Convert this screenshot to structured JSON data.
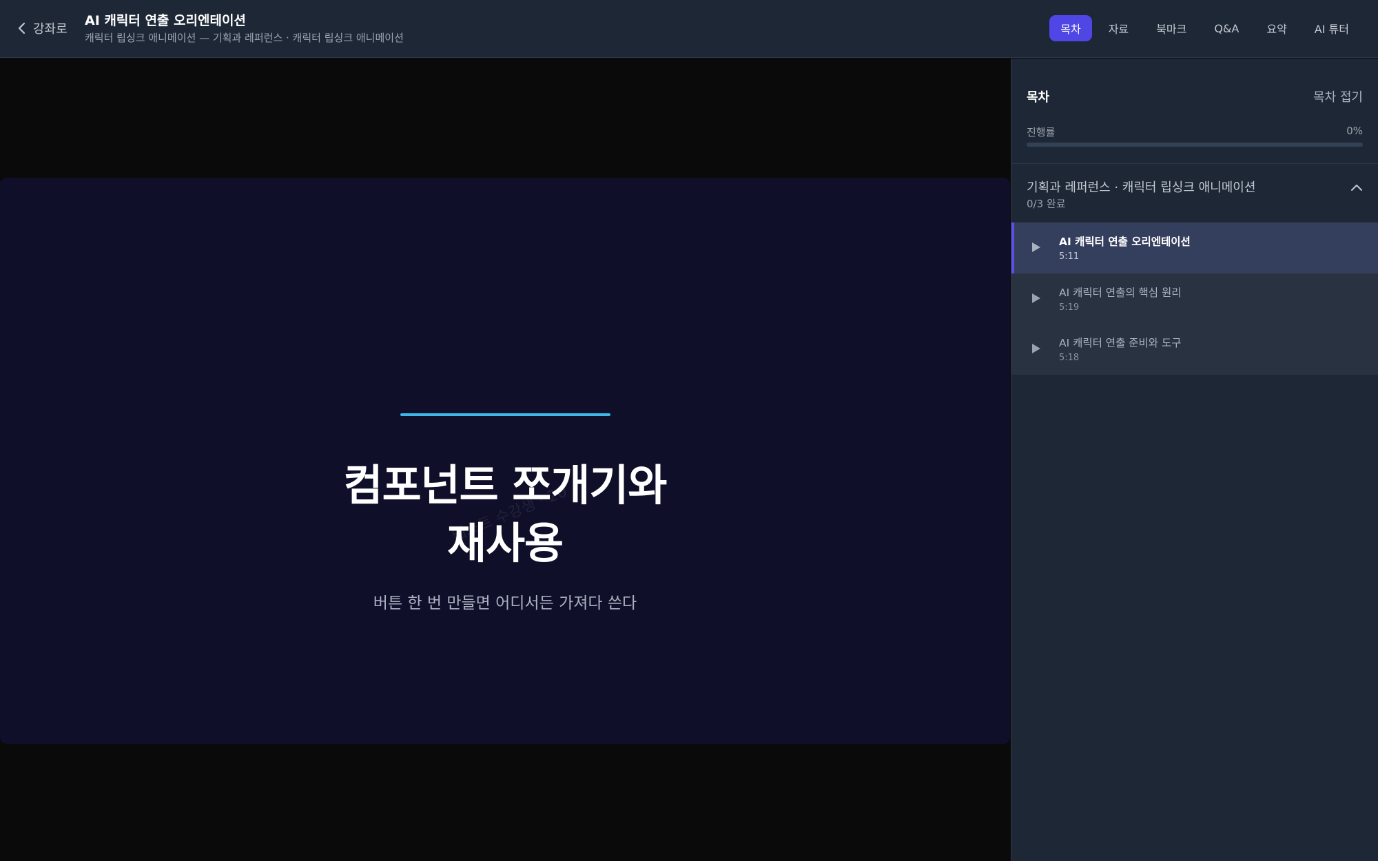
{
  "header": {
    "back_label": "강좌로",
    "title": "AI 캐릭터 연출 오리엔테이션",
    "subtitle": "캐릭터 립싱크 애니메이션 — 기획과 레퍼런스 · 캐릭터 립싱크 애니메이션",
    "tabs": [
      {
        "label": "목차",
        "active": true
      },
      {
        "label": "자료",
        "active": false
      },
      {
        "label": "북마크",
        "active": false
      },
      {
        "label": "Q&A",
        "active": false
      },
      {
        "label": "요약",
        "active": false
      },
      {
        "label": "AI 튜터",
        "active": false
      }
    ]
  },
  "slide": {
    "title_line1": "컴포넌트 쪼개기와",
    "title_line2": "재사용",
    "subtitle": "버튼 한 번 만들면 어디서든 가져다 쓴다",
    "watermark": "테스트 수강생 · 20",
    "accent_color": "#3db6ea",
    "background_color": "#0f0f2a"
  },
  "sidebar": {
    "title": "목차",
    "collapse_label": "목차 접기",
    "progress_label": "진행률",
    "progress_value": "0%",
    "progress_fraction": 0,
    "section": {
      "title": "기획과 레퍼런스 · 캐릭터 립싱크 애니메이션",
      "count": "0/3 완료",
      "expanded": true
    },
    "lessons": [
      {
        "title": "AI 캐릭터 연출 오리엔테이션",
        "duration": "5:11",
        "active": true
      },
      {
        "title": "AI 캐릭터 연출의 핵심 원리",
        "duration": "5:19",
        "active": false
      },
      {
        "title": "AI 캐릭터 연출 준비와 도구",
        "duration": "5:18",
        "active": false
      }
    ]
  },
  "colors": {
    "accent": "#4f46e5",
    "header_bg": "#1e2735",
    "sidebar_bg": "#1e2735"
  },
  "icons": [
    "chevron-left-icon",
    "chevron-up-icon",
    "play-icon"
  ]
}
